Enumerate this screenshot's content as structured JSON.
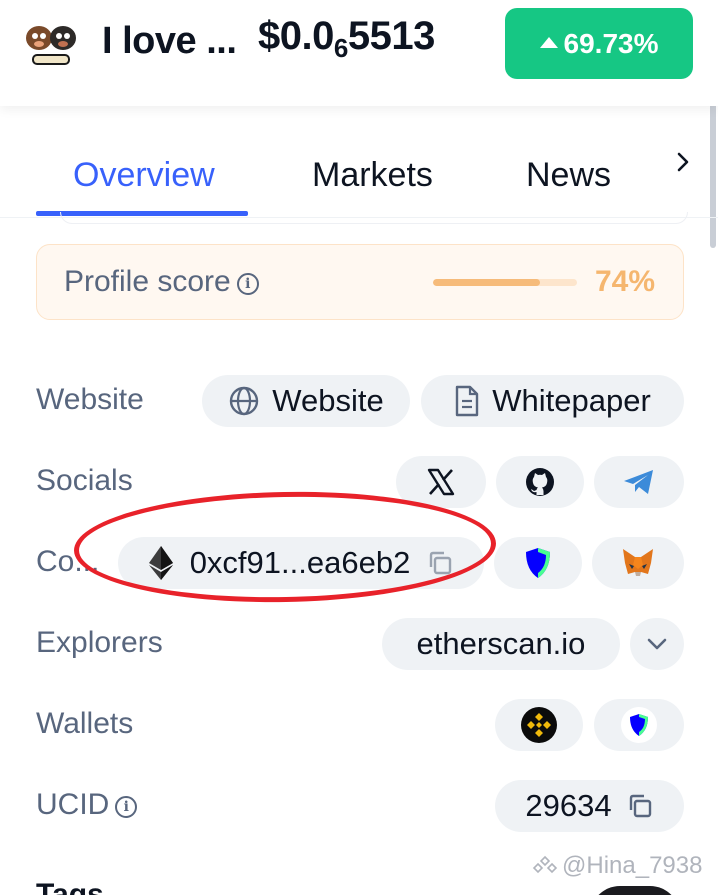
{
  "header": {
    "coin_name": "I love ...",
    "price_prefix": "$0.0",
    "price_zeros": "6",
    "price_suffix": "5513",
    "change": "69.73%",
    "change_color": "#16c784"
  },
  "tabs": [
    {
      "label": "Overview",
      "active": true
    },
    {
      "label": "Markets",
      "active": false
    },
    {
      "label": "News",
      "active": false
    }
  ],
  "profile": {
    "label": "Profile score",
    "value": "74%",
    "fraction": 0.74
  },
  "rows": {
    "website": {
      "label": "Website",
      "links": [
        "Website",
        "Whitepaper"
      ]
    },
    "socials": {
      "label": "Socials",
      "icons": [
        "x-icon",
        "github-icon",
        "telegram-icon"
      ]
    },
    "contracts": {
      "label": "Co...",
      "address": "0xcf91...ea6eb2",
      "icons": [
        "ethereum-icon",
        "copy-icon",
        "trustwallet-shield-icon",
        "metamask-fox-icon"
      ]
    },
    "explorers": {
      "label": "Explorers",
      "value": "etherscan.io"
    },
    "wallets": {
      "label": "Wallets",
      "icons": [
        "binance-web3-wallet-icon",
        "trustwallet-shield-icon"
      ]
    },
    "ucid": {
      "label": "UCID",
      "value": "29634"
    }
  },
  "tags_label": "Tags",
  "watermark": "@Hina_7938",
  "colors": {
    "accent": "#3861fb",
    "annotation": "#e8222a",
    "score": "#f5b66f"
  }
}
